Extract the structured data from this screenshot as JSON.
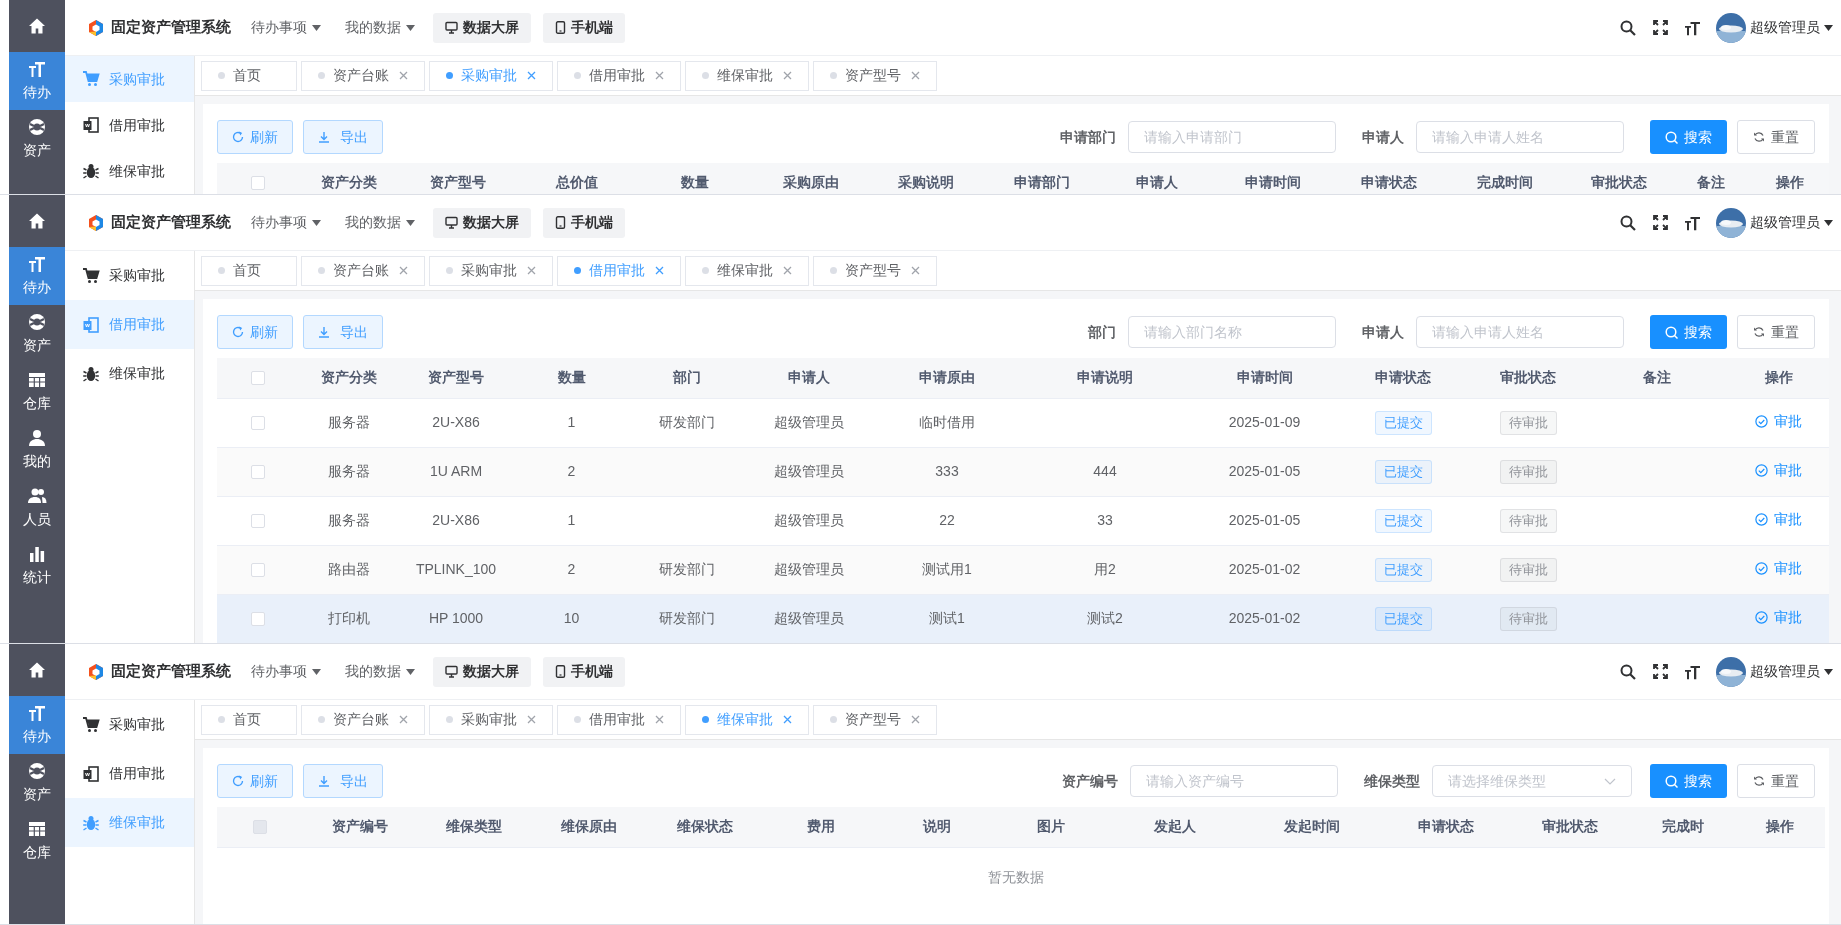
{
  "panels": [
    {
      "rail": [
        {
          "label": "待办",
          "selected": true
        },
        {
          "label": "资产",
          "selected": false
        }
      ],
      "header": {
        "title": "固定资产管理系统",
        "menus": [
          "待办事项",
          "我的数据"
        ],
        "buttons": [
          "数据大屏",
          "手机端"
        ],
        "user": "超级管理员"
      },
      "subnav": [
        {
          "label": "采购审批",
          "selected": true
        },
        {
          "label": "借用审批",
          "selected": false
        },
        {
          "label": "维保审批",
          "selected": false
        }
      ],
      "tabs": [
        {
          "label": "首页",
          "selected": false,
          "closable": false
        },
        {
          "label": "资产台账",
          "selected": false,
          "closable": true
        },
        {
          "label": "采购审批",
          "selected": true,
          "closable": true
        },
        {
          "label": "借用审批",
          "selected": false,
          "closable": true
        },
        {
          "label": "维保审批",
          "selected": false,
          "closable": true
        },
        {
          "label": "资产型号",
          "selected": false,
          "closable": true
        }
      ],
      "toolbar": {
        "actions": [
          "刷新",
          "导出"
        ],
        "filters": [
          {
            "label": "申请部门",
            "placeholder": "请输入申请部门",
            "kind": "input"
          },
          {
            "label": "申请人",
            "placeholder": "请输入申请人姓名",
            "kind": "input"
          }
        ],
        "search": "搜索",
        "reset": "重置"
      },
      "table": {
        "select_all_disabled": false,
        "columns": [
          "资产分类",
          "资产型号",
          "总价值",
          "数量",
          "采购原由",
          "采购说明",
          "申请部门",
          "申请人",
          "申请时间",
          "申请状态",
          "完成时间",
          "审批状态",
          "备注",
          "操作"
        ]
      }
    },
    {
      "rail": [
        {
          "label": "待办",
          "selected": true
        },
        {
          "label": "资产",
          "selected": false
        },
        {
          "label": "仓库",
          "selected": false
        },
        {
          "label": "我的",
          "selected": false
        },
        {
          "label": "人员",
          "selected": false
        },
        {
          "label": "统计",
          "selected": false
        }
      ],
      "header": {
        "title": "固定资产管理系统",
        "menus": [
          "待办事项",
          "我的数据"
        ],
        "buttons": [
          "数据大屏",
          "手机端"
        ],
        "user": "超级管理员"
      },
      "subnav": [
        {
          "label": "采购审批",
          "selected": false
        },
        {
          "label": "借用审批",
          "selected": true
        },
        {
          "label": "维保审批",
          "selected": false
        }
      ],
      "tabs": [
        {
          "label": "首页",
          "selected": false,
          "closable": false
        },
        {
          "label": "资产台账",
          "selected": false,
          "closable": true
        },
        {
          "label": "采购审批",
          "selected": false,
          "closable": true
        },
        {
          "label": "借用审批",
          "selected": true,
          "closable": true
        },
        {
          "label": "维保审批",
          "selected": false,
          "closable": true
        },
        {
          "label": "资产型号",
          "selected": false,
          "closable": true
        }
      ],
      "toolbar": {
        "actions": [
          "刷新",
          "导出"
        ],
        "filters": [
          {
            "label": "部门",
            "placeholder": "请输入部门名称",
            "kind": "input"
          },
          {
            "label": "申请人",
            "placeholder": "请输入申请人姓名",
            "kind": "input"
          }
        ],
        "search": "搜索",
        "reset": "重置"
      },
      "table": {
        "select_all_disabled": false,
        "columns": [
          "资产分类",
          "资产型号",
          "数量",
          "部门",
          "申请人",
          "申请原由",
          "申请说明",
          "申请时间",
          "申请状态",
          "审批状态",
          "备注",
          "操作"
        ],
        "rows": [
          {
            "checked": false,
            "highlighted": false,
            "cells": [
              {
                "kind": "text",
                "text": "服务器"
              },
              {
                "kind": "text",
                "text": "2U-X86"
              },
              {
                "kind": "text",
                "text": "1"
              },
              {
                "kind": "text",
                "text": "研发部门"
              },
              {
                "kind": "text",
                "text": "超级管理员"
              },
              {
                "kind": "text",
                "text": "临时借用"
              },
              null,
              {
                "kind": "text",
                "text": "2025-01-09"
              },
              {
                "kind": "tag",
                "color": "#409eff",
                "text": "已提交"
              },
              {
                "kind": "tag",
                "color": "#909399",
                "text": "待审批"
              },
              null,
              {
                "kind": "action",
                "text": "审批"
              }
            ]
          },
          {
            "checked": false,
            "highlighted": false,
            "cells": [
              {
                "kind": "text",
                "text": "服务器"
              },
              {
                "kind": "text",
                "text": "1U ARM"
              },
              {
                "kind": "text",
                "text": "2"
              },
              null,
              {
                "kind": "text",
                "text": "超级管理员"
              },
              {
                "kind": "text",
                "text": "333"
              },
              {
                "kind": "text",
                "text": "444"
              },
              {
                "kind": "text",
                "text": "2025-01-05"
              },
              {
                "kind": "tag",
                "color": "#409eff",
                "text": "已提交"
              },
              {
                "kind": "tag",
                "color": "#909399",
                "text": "待审批"
              },
              null,
              {
                "kind": "action",
                "text": "审批"
              }
            ]
          },
          {
            "checked": false,
            "highlighted": false,
            "cells": [
              {
                "kind": "text",
                "text": "服务器"
              },
              {
                "kind": "text",
                "text": "2U-X86"
              },
              {
                "kind": "text",
                "text": "1"
              },
              null,
              {
                "kind": "text",
                "text": "超级管理员"
              },
              {
                "kind": "text",
                "text": "22"
              },
              {
                "kind": "text",
                "text": "33"
              },
              {
                "kind": "text",
                "text": "2025-01-05"
              },
              {
                "kind": "tag",
                "color": "#409eff",
                "text": "已提交"
              },
              {
                "kind": "tag",
                "color": "#909399",
                "text": "待审批"
              },
              null,
              {
                "kind": "action",
                "text": "审批"
              }
            ]
          },
          {
            "checked": false,
            "highlighted": false,
            "cells": [
              {
                "kind": "text",
                "text": "路由器"
              },
              {
                "kind": "text",
                "text": "TPLINK_100"
              },
              {
                "kind": "text",
                "text": "2"
              },
              {
                "kind": "text",
                "text": "研发部门"
              },
              {
                "kind": "text",
                "text": "超级管理员"
              },
              {
                "kind": "text",
                "text": "测试用1"
              },
              {
                "kind": "text",
                "text": "用2"
              },
              {
                "kind": "text",
                "text": "2025-01-02"
              },
              {
                "kind": "tag",
                "color": "#409eff",
                "text": "已提交"
              },
              {
                "kind": "tag",
                "color": "#909399",
                "text": "待审批"
              },
              null,
              {
                "kind": "action",
                "text": "审批"
              }
            ]
          },
          {
            "checked": false,
            "highlighted": true,
            "cells": [
              {
                "kind": "text",
                "text": "打印机"
              },
              {
                "kind": "text",
                "text": "HP 1000"
              },
              {
                "kind": "text",
                "text": "10"
              },
              {
                "kind": "text",
                "text": "研发部门"
              },
              {
                "kind": "text",
                "text": "超级管理员"
              },
              {
                "kind": "text",
                "text": "测试1"
              },
              {
                "kind": "text",
                "text": "测试2"
              },
              {
                "kind": "text",
                "text": "2025-01-02"
              },
              {
                "kind": "tag",
                "color": "#409eff",
                "text": "已提交"
              },
              {
                "kind": "tag",
                "color": "#909399",
                "text": "待审批"
              },
              null,
              {
                "kind": "action",
                "text": "审批"
              }
            ]
          }
        ]
      }
    },
    {
      "rail": [
        {
          "label": "待办",
          "selected": true
        },
        {
          "label": "资产",
          "selected": false
        },
        {
          "label": "仓库",
          "selected": false
        }
      ],
      "header": {
        "title": "固定资产管理系统",
        "menus": [
          "待办事项",
          "我的数据"
        ],
        "buttons": [
          "数据大屏",
          "手机端"
        ],
        "user": "超级管理员"
      },
      "subnav": [
        {
          "label": "采购审批",
          "selected": false
        },
        {
          "label": "借用审批",
          "selected": false
        },
        {
          "label": "维保审批",
          "selected": true
        }
      ],
      "tabs": [
        {
          "label": "首页",
          "selected": false,
          "closable": false
        },
        {
          "label": "资产台账",
          "selected": false,
          "closable": true
        },
        {
          "label": "采购审批",
          "selected": false,
          "closable": true
        },
        {
          "label": "借用审批",
          "selected": false,
          "closable": true
        },
        {
          "label": "维保审批",
          "selected": true,
          "closable": true
        },
        {
          "label": "资产型号",
          "selected": false,
          "closable": true
        }
      ],
      "toolbar": {
        "actions": [
          "刷新",
          "导出"
        ],
        "filters": [
          {
            "label": "资产编号",
            "placeholder": "请输入资产编号",
            "kind": "input"
          },
          {
            "label": "维保类型",
            "placeholder": "请选择维保类型",
            "kind": "select"
          }
        ],
        "search": "搜索",
        "reset": "重置"
      },
      "table": {
        "select_all_disabled": true,
        "columns": [
          "资产编号",
          "维保类型",
          "维保原由",
          "维保状态",
          "费用",
          "说明",
          "图片",
          "发起人",
          "发起时间",
          "申请状态",
          "审批状态",
          "完成时",
          "操作"
        ],
        "empty_text": "暂无数据"
      }
    }
  ]
}
